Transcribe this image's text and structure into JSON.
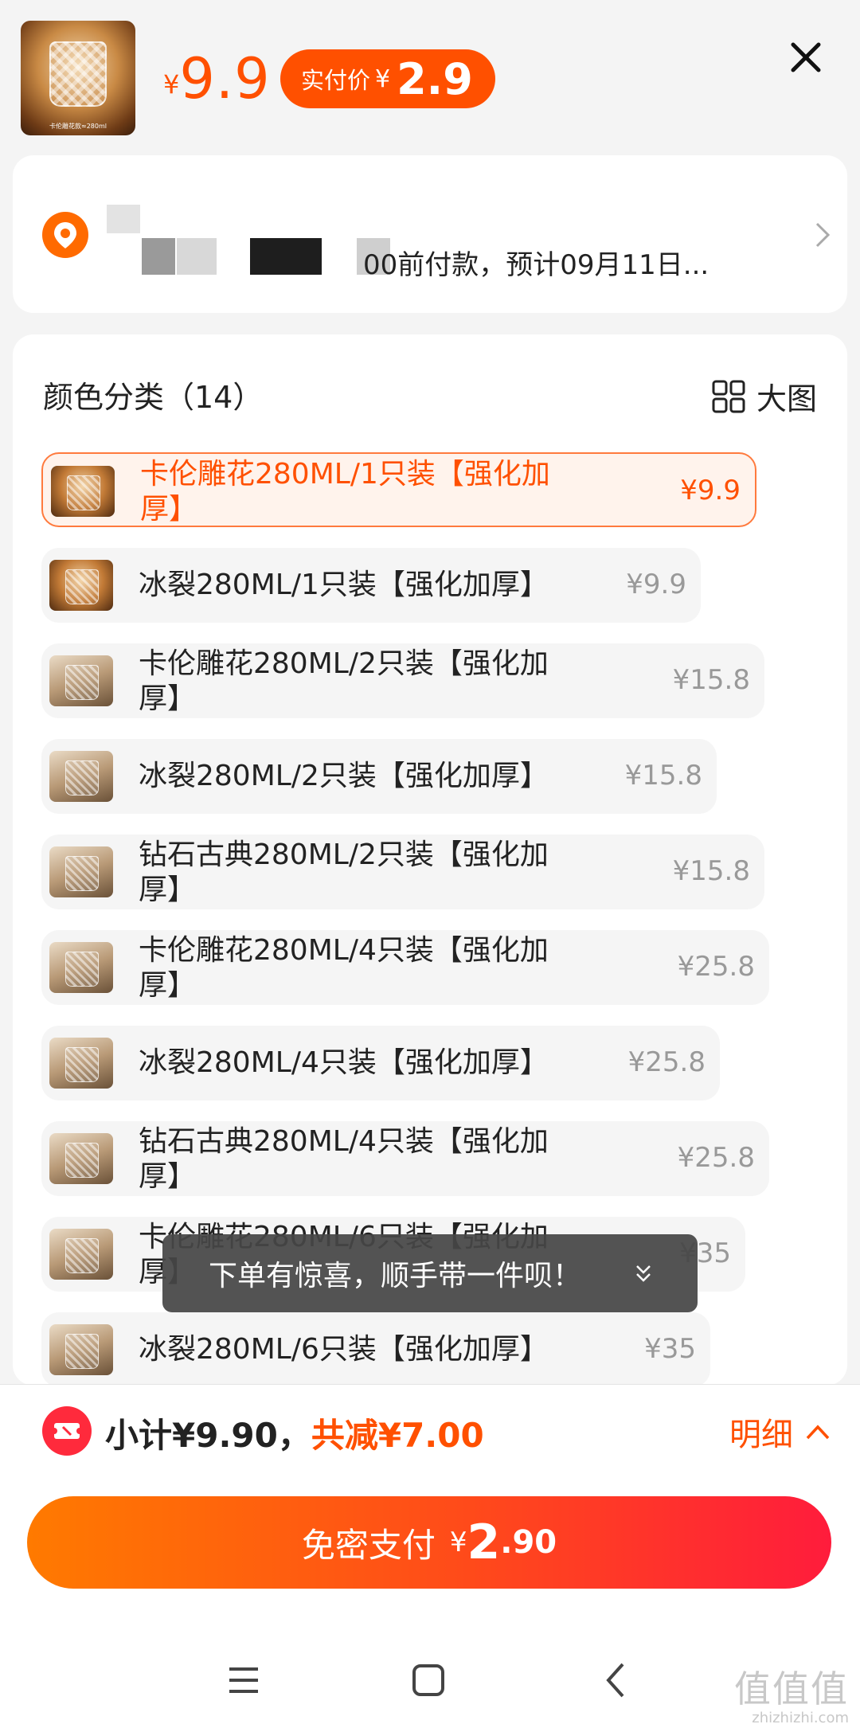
{
  "header": {
    "thumb_caption": "卡伦雕花款≈280ml",
    "price_symbol": "¥",
    "price": "9.9",
    "paid_label": "实付价",
    "paid_symbol": "¥",
    "paid_price": "2.9"
  },
  "address": {
    "visible_text": "00前付款，预计09月11日..."
  },
  "sku": {
    "title": "颜色分类（14）",
    "big_image_label": "大图",
    "options": [
      {
        "name_line1": "卡伦雕花280ML/1只装【强化加",
        "name_line2": "厚】",
        "price": "¥9.9",
        "selected": true
      },
      {
        "name_line1": "冰裂280ML/1只装【强化加厚】",
        "name_line2": "",
        "price": "¥9.9",
        "selected": false
      },
      {
        "name_line1": "卡伦雕花280ML/2只装【强化加",
        "name_line2": "厚】",
        "price": "¥15.8",
        "selected": false
      },
      {
        "name_line1": "冰裂280ML/2只装【强化加厚】",
        "name_line2": "",
        "price": "¥15.8",
        "selected": false
      },
      {
        "name_line1": "钻石古典280ML/2只装【强化加",
        "name_line2": "厚】",
        "price": "¥15.8",
        "selected": false
      },
      {
        "name_line1": "卡伦雕花280ML/4只装【强化加",
        "name_line2": "厚】",
        "price": "¥25.8",
        "selected": false
      },
      {
        "name_line1": "冰裂280ML/4只装【强化加厚】",
        "name_line2": "",
        "price": "¥25.8",
        "selected": false
      },
      {
        "name_line1": "钻石古典280ML/4只装【强化加",
        "name_line2": "厚】",
        "price": "¥25.8",
        "selected": false
      },
      {
        "name_line1": "卡伦雕花280ML/6只装【强化加",
        "name_line2": "厚】",
        "price": "¥35",
        "selected": false
      },
      {
        "name_line1": "冰裂280ML/6只装【强化加厚】",
        "name_line2": "",
        "price": "¥35",
        "selected": false
      }
    ]
  },
  "toast": {
    "text": "下单有惊喜，顺手带一件呗！"
  },
  "footer": {
    "subtotal_label": "小计¥9.90，",
    "discount_label": "共减¥7.00",
    "detail_label": "明细",
    "pay_label": "免密支付",
    "pay_symbol": "¥",
    "pay_int": "2",
    "pay_dec": ".90"
  },
  "watermark": {
    "text": "值值值",
    "url": "zhizhizhi.com"
  },
  "colors": {
    "accent": "#ff5000",
    "pay_gradient_start": "#ff7a00",
    "pay_gradient_end": "#ff1c3c"
  }
}
